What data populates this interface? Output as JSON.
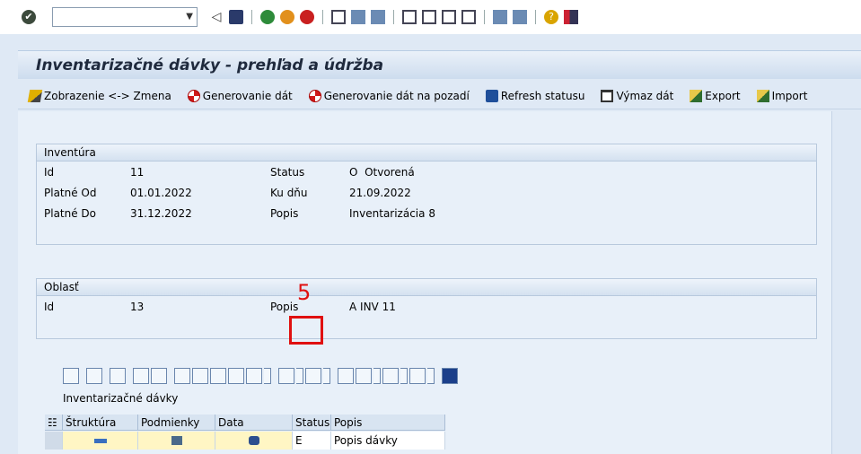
{
  "window": {
    "title": "Inventarizačné dávky - prehľad a údržba"
  },
  "system_toolbar": {
    "command_value": ""
  },
  "app_toolbar": {
    "display_change": "Zobrazenie <-> Zmena",
    "generate": "Generovanie dát",
    "generate_bg": "Generovanie dát na pozadí",
    "refresh": "Refresh statusu",
    "delete": "Výmaz dát",
    "export": "Export",
    "import": "Import"
  },
  "inventura": {
    "header": "Inventúra",
    "id_label": "Id",
    "id_value": "11",
    "valid_from_label": "Platné Od",
    "valid_from_value": "01.01.2022",
    "valid_to_label": "Platné Do",
    "valid_to_value": "31.12.2022",
    "status_label": "Status",
    "status_value": "O  Otvorená",
    "date_label": "Ku dňu",
    "date_value": "21.09.2022",
    "desc_label": "Popis",
    "desc_value": "Inventarizácia 8"
  },
  "oblast": {
    "header": "Oblasť",
    "id_label": "Id",
    "id_value": "13",
    "desc_label": "Popis",
    "desc_value": "A INV 11"
  },
  "grid": {
    "title": "Inventarizačné dávky",
    "columns": [
      "Štruktúra",
      "Podmienky",
      "Data",
      "Status",
      "Popis"
    ],
    "rows": [
      {
        "status": "E",
        "popis": "Popis dávky"
      }
    ]
  },
  "annotation": {
    "step": "5",
    "color": "#e01010"
  }
}
